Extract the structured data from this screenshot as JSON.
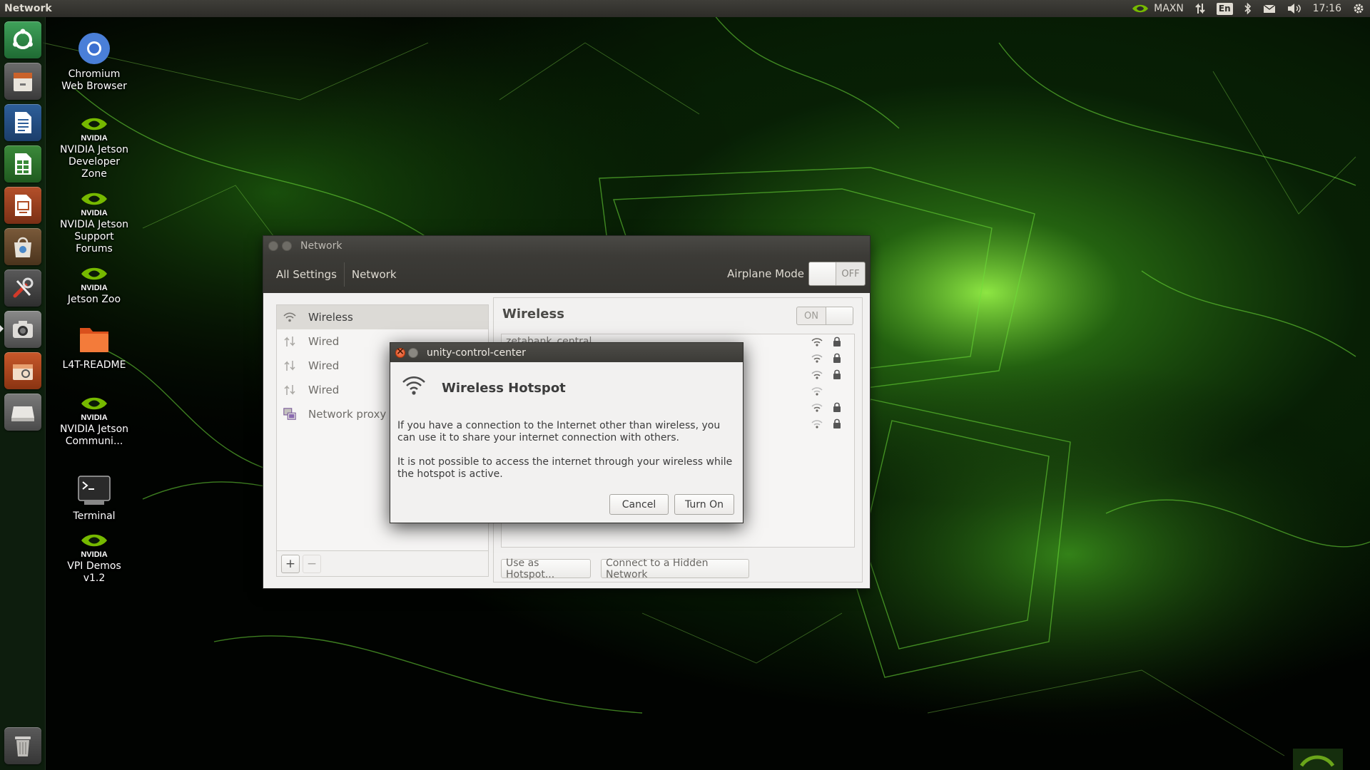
{
  "top_panel": {
    "app_title": "Network",
    "power_mode": "MAXN",
    "keyboard_layout": "En",
    "clock": "17:16"
  },
  "launcher": {
    "items": [
      "chromium-browser",
      "files",
      "writer",
      "calc",
      "impress",
      "software-center",
      "system-settings",
      "screenshot",
      "archive-manager",
      "disk",
      "trash"
    ]
  },
  "desktop_icons": [
    {
      "label": "Chromium Web Browser"
    },
    {
      "label": "NVIDIA Jetson Developer Zone"
    },
    {
      "label": "NVIDIA Jetson Support Forums"
    },
    {
      "label": "Jetson Zoo"
    },
    {
      "label": "L4T-README"
    },
    {
      "label": "NVIDIA Jetson Communi..."
    },
    {
      "label": "Terminal"
    },
    {
      "label": "VPI Demos v1.2"
    }
  ],
  "nvidia_wordmark": "NVIDIA",
  "network_window": {
    "title": "Network",
    "breadcrumb": [
      "All Settings",
      "Network"
    ],
    "airplane_mode": {
      "label": "Airplane Mode",
      "state": "OFF"
    },
    "sidebar": [
      {
        "label": "Wireless",
        "icon": "wifi-icon",
        "selected": true
      },
      {
        "label": "Wired",
        "icon": "wired-icon"
      },
      {
        "label": "Wired",
        "icon": "wired-icon"
      },
      {
        "label": "Wired",
        "icon": "wired-icon"
      },
      {
        "label": "Network proxy",
        "icon": "proxy-icon"
      }
    ],
    "sidebar_add": "+",
    "sidebar_remove": "−",
    "main": {
      "heading": "Wireless",
      "switch_state": "ON",
      "access_points": [
        {
          "name": "zetabank_central",
          "secured": true
        },
        {
          "name": "",
          "secured": true
        },
        {
          "name": "",
          "secured": true
        },
        {
          "name": "",
          "secured": false
        },
        {
          "name": "",
          "secured": true
        },
        {
          "name": "",
          "secured": true
        }
      ],
      "hotspot_button": "Use as Hotspot...",
      "hidden_network_button": "Connect to a Hidden Network"
    }
  },
  "dialog": {
    "title": "unity-control-center",
    "heading": "Wireless Hotspot",
    "paragraph1": "If you have a connection to the Internet other than wireless, you can use it to share your internet connection with others.",
    "paragraph2": "It is not possible to access the internet through your wireless while the hotspot is active.",
    "cancel_label": "Cancel",
    "confirm_label": "Turn On"
  }
}
